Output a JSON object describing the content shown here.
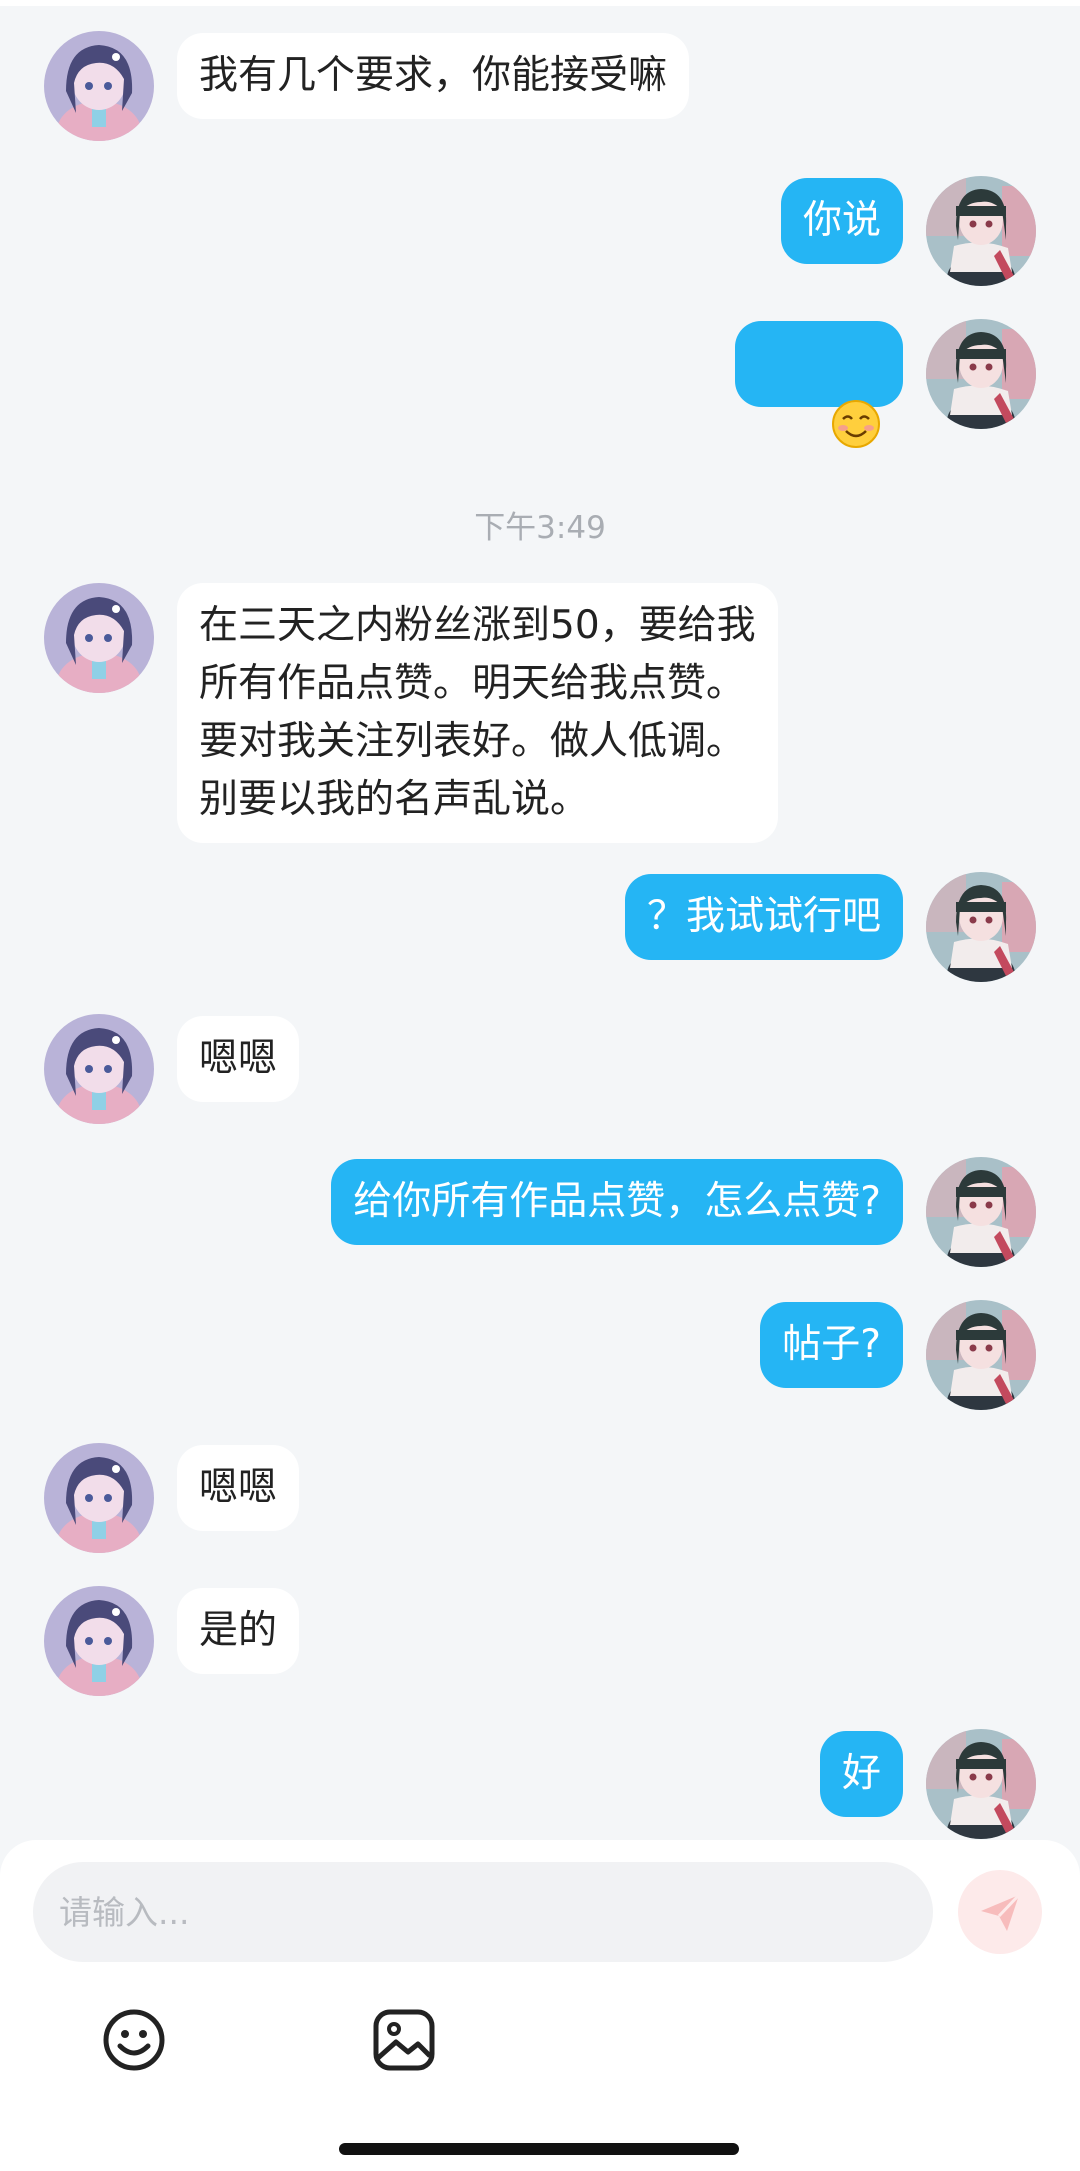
{
  "messages": {
    "m1": {
      "from": "other",
      "text": "我有几个要求，你能接受嘛"
    },
    "m2": {
      "from": "me",
      "text": "你说"
    },
    "m3": {
      "from": "me",
      "text": "☺️"
    },
    "time1": "下午3:49",
    "m4": {
      "from": "other",
      "text": "在三天之内粉丝涨到50，要给我\n所有作品点赞。明天给我点赞。\n要对我关注列表好。做人低调。\n别要以我的名声乱说。"
    },
    "m5": {
      "from": "me",
      "text": "？我试试行吧"
    },
    "m6": {
      "from": "other",
      "text": "嗯嗯"
    },
    "m7": {
      "from": "me",
      "text": "给你所有作品点赞，怎么点赞?"
    },
    "m8": {
      "from": "me",
      "text": "帖子?"
    },
    "m9": {
      "from": "other",
      "text": "嗯嗯"
    },
    "m10": {
      "from": "other",
      "text": "是的"
    },
    "m11": {
      "from": "me",
      "text": "好"
    }
  },
  "composer": {
    "placeholder": "请输入...",
    "send_icon": "paper-plane-icon",
    "tools": [
      "smiley-icon",
      "image-icon"
    ]
  },
  "colors": {
    "background": "#f4f6f8",
    "incoming_bubble": "#ffffff",
    "outgoing_bubble": "#25b5f4",
    "send_button": "#fdeaea",
    "send_arrow": "#f7bcbc"
  }
}
